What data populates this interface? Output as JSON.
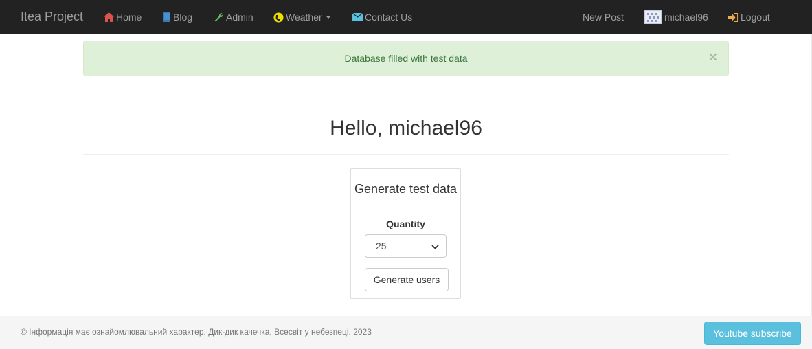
{
  "navbar": {
    "brand": "Itea Project",
    "items": [
      {
        "label": "Home",
        "icon": "home-icon"
      },
      {
        "label": "Blog",
        "icon": "book-icon"
      },
      {
        "label": "Admin",
        "icon": "wrench-icon"
      },
      {
        "label": "Weather",
        "icon": "globe-icon"
      },
      {
        "label": "Contact Us",
        "icon": "envelope-icon"
      }
    ],
    "right": {
      "new_post": "New Post",
      "username": "michael96",
      "logout": "Logout"
    },
    "colors": {
      "background": "#222222",
      "text": "#9d9d9d",
      "home_icon": "#d9534f",
      "blog_icon": "#337ab7",
      "admin_icon": "#5cb85c",
      "weather_icon": "#f0e000",
      "contact_icon": "#5bc0de",
      "logout_icon": "#f0ad4e"
    }
  },
  "alert": {
    "message": "Database filled with test data",
    "close": "×"
  },
  "main": {
    "title": "Hello, michael96",
    "panel": {
      "title": "Generate test data",
      "quantity_label": "Quantity",
      "quantity_value": "25",
      "button": "Generate users"
    }
  },
  "footer": {
    "text": "© Інформація має ознайомлювальний характер. Дик-дик качечка, Всесвіт у небезпеці. 2023",
    "youtube_button": "Youtube subscribe"
  }
}
